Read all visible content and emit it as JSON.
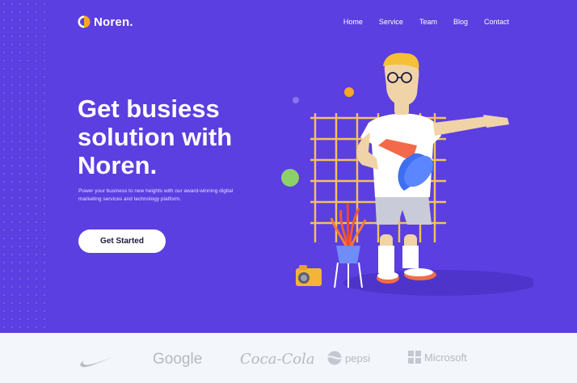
{
  "brand": {
    "name": "Noren."
  },
  "nav": {
    "items": [
      {
        "label": "Home"
      },
      {
        "label": "Service"
      },
      {
        "label": "Team"
      },
      {
        "label": "Blog"
      },
      {
        "label": "Contact"
      }
    ]
  },
  "hero": {
    "headline": [
      "Get busiess",
      "solution with",
      "Noren."
    ],
    "subtext": "Power your business to new heights with our award-winning digital marketing services and technology platform.",
    "cta_label": "Get Started"
  },
  "partners": {
    "logos": [
      {
        "name": "nike",
        "text": ""
      },
      {
        "name": "google",
        "text": "Google"
      },
      {
        "name": "coca-cola",
        "text": "Coca-Cola"
      },
      {
        "name": "pepsi",
        "text": "pepsi"
      },
      {
        "name": "microsoft",
        "text": "Microsoft"
      }
    ]
  },
  "colors": {
    "hero_bg": "#5b3fe0",
    "accent_orange": "#f7a823",
    "grid_yellow": "#f4c25a",
    "logo_gray": "#b6b9c1"
  }
}
